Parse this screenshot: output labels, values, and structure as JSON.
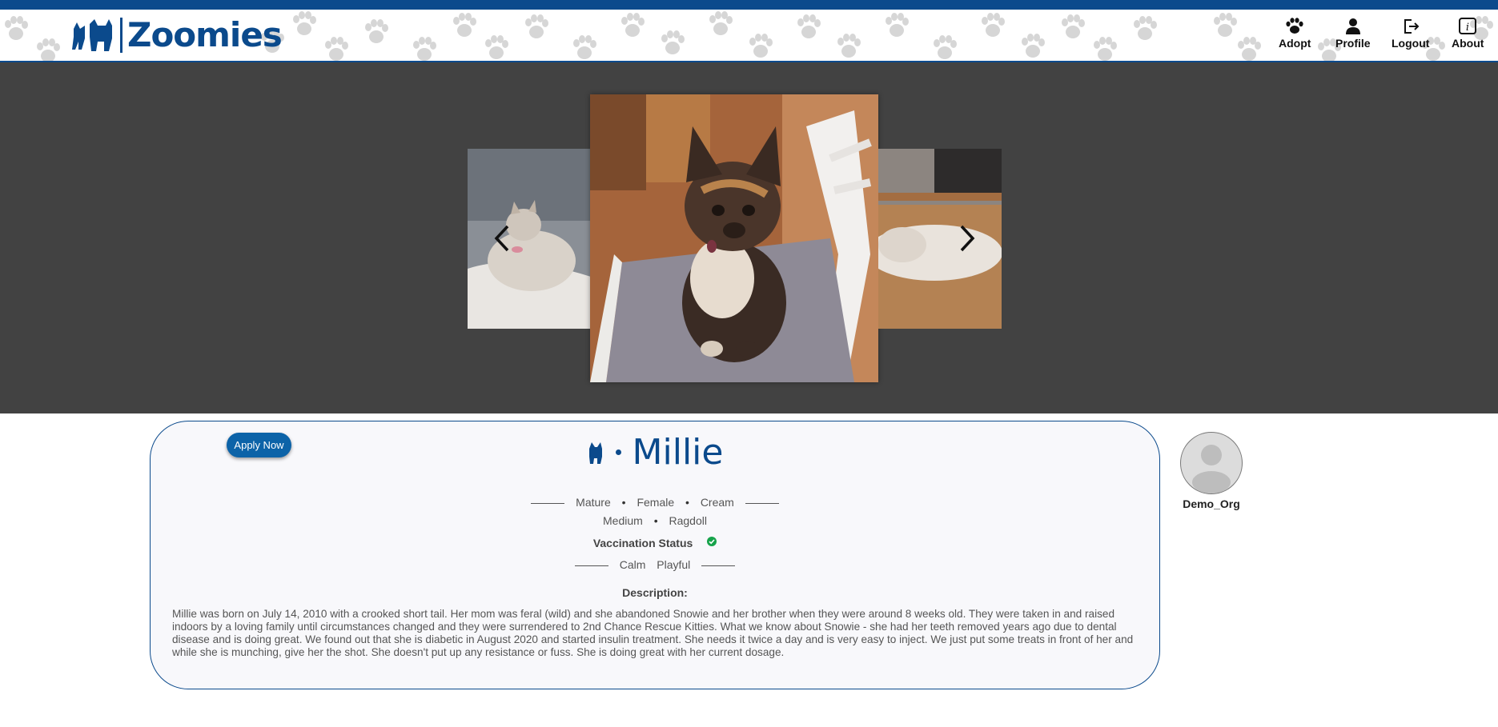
{
  "brand": {
    "name": "Zoomies"
  },
  "nav": {
    "adopt": "Adopt",
    "profile": "Profile",
    "logout": "Logout",
    "about": "About"
  },
  "carousel": {
    "images": [
      "cat-photo-left",
      "cat-photo-main",
      "cat-photo-right"
    ]
  },
  "pet": {
    "name": "Millie",
    "apply_label": "Apply Now",
    "age": "Mature",
    "sex": "Female",
    "color": "Cream",
    "size": "Medium",
    "breed": "Ragdoll",
    "vaccination_label": "Vaccination Status",
    "traits": [
      "Calm",
      "Playful"
    ],
    "description_label": "Description:",
    "description": "Millie was born on July 14, 2010 with a crooked short tail. Her mom was feral (wild) and she abandoned Snowie and her brother when they were around 8 weeks old. They were taken in and raised indoors by a loving family until circumstances changed and they were surrendered to 2nd Chance Rescue Kitties. What we know about Snowie - she had her teeth removed years ago due to dental disease and is doing great. We found out that she is diabetic in August 2020 and started insulin treatment. She needs it twice a day and is very easy to inject. We just put some treats in front of her and while she is munching, give her the shot. She doesn't put up any resistance or fuss. She is doing great with her current dosage."
  },
  "organization": {
    "name": "Demo_Org"
  },
  "colors": {
    "brand": "#0b4a8c",
    "hero_bg": "#424242",
    "button": "#0c63a8",
    "check": "#16a34a"
  }
}
